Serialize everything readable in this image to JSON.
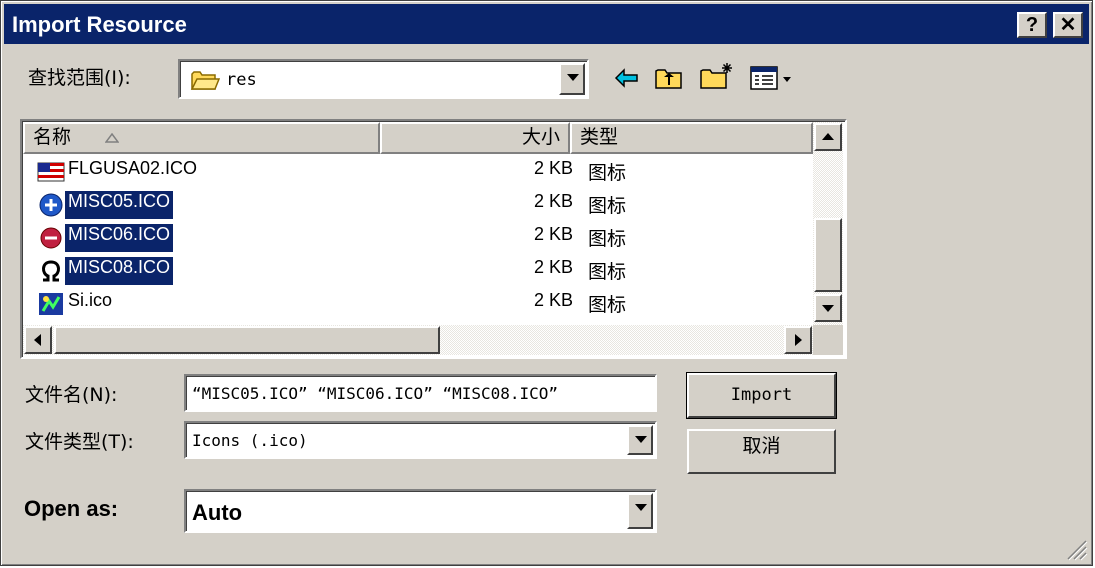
{
  "window": {
    "title": "Import Resource",
    "help_label": "?",
    "close_label": "✕"
  },
  "lookin": {
    "label": "查找范围(I):",
    "value": "res"
  },
  "list": {
    "columns": [
      "名称",
      "大小",
      "类型"
    ],
    "rows": [
      {
        "name": "FLGUSA02.ICO",
        "size": "2 KB",
        "type": "图标",
        "selected": false,
        "icon": "us-flag-icon"
      },
      {
        "name": "MISC05.ICO",
        "size": "2 KB",
        "type": "图标",
        "selected": true,
        "icon": "plus-circle-icon"
      },
      {
        "name": "MISC06.ICO",
        "size": "2 KB",
        "type": "图标",
        "selected": true,
        "icon": "minus-circle-icon"
      },
      {
        "name": "MISC08.ICO",
        "size": "2 KB",
        "type": "图标",
        "selected": true,
        "icon": "omega-icon"
      },
      {
        "name": "Si.ico",
        "size": "2 KB",
        "type": "图标",
        "selected": false,
        "icon": "si-icon"
      }
    ]
  },
  "filename": {
    "label": "文件名(N):",
    "value": "“MISC05.ICO” “MISC06.ICO” “MISC08.ICO”"
  },
  "filetype": {
    "label": "文件类型(T):",
    "value": "Icons (.ico)"
  },
  "openas": {
    "label": "Open as:",
    "value": "Auto"
  },
  "buttons": {
    "import": "Import",
    "cancel": "取消"
  },
  "colors": {
    "titlebar": "#0a246a",
    "face": "#d4d0c8",
    "selection": "#0a246a"
  }
}
